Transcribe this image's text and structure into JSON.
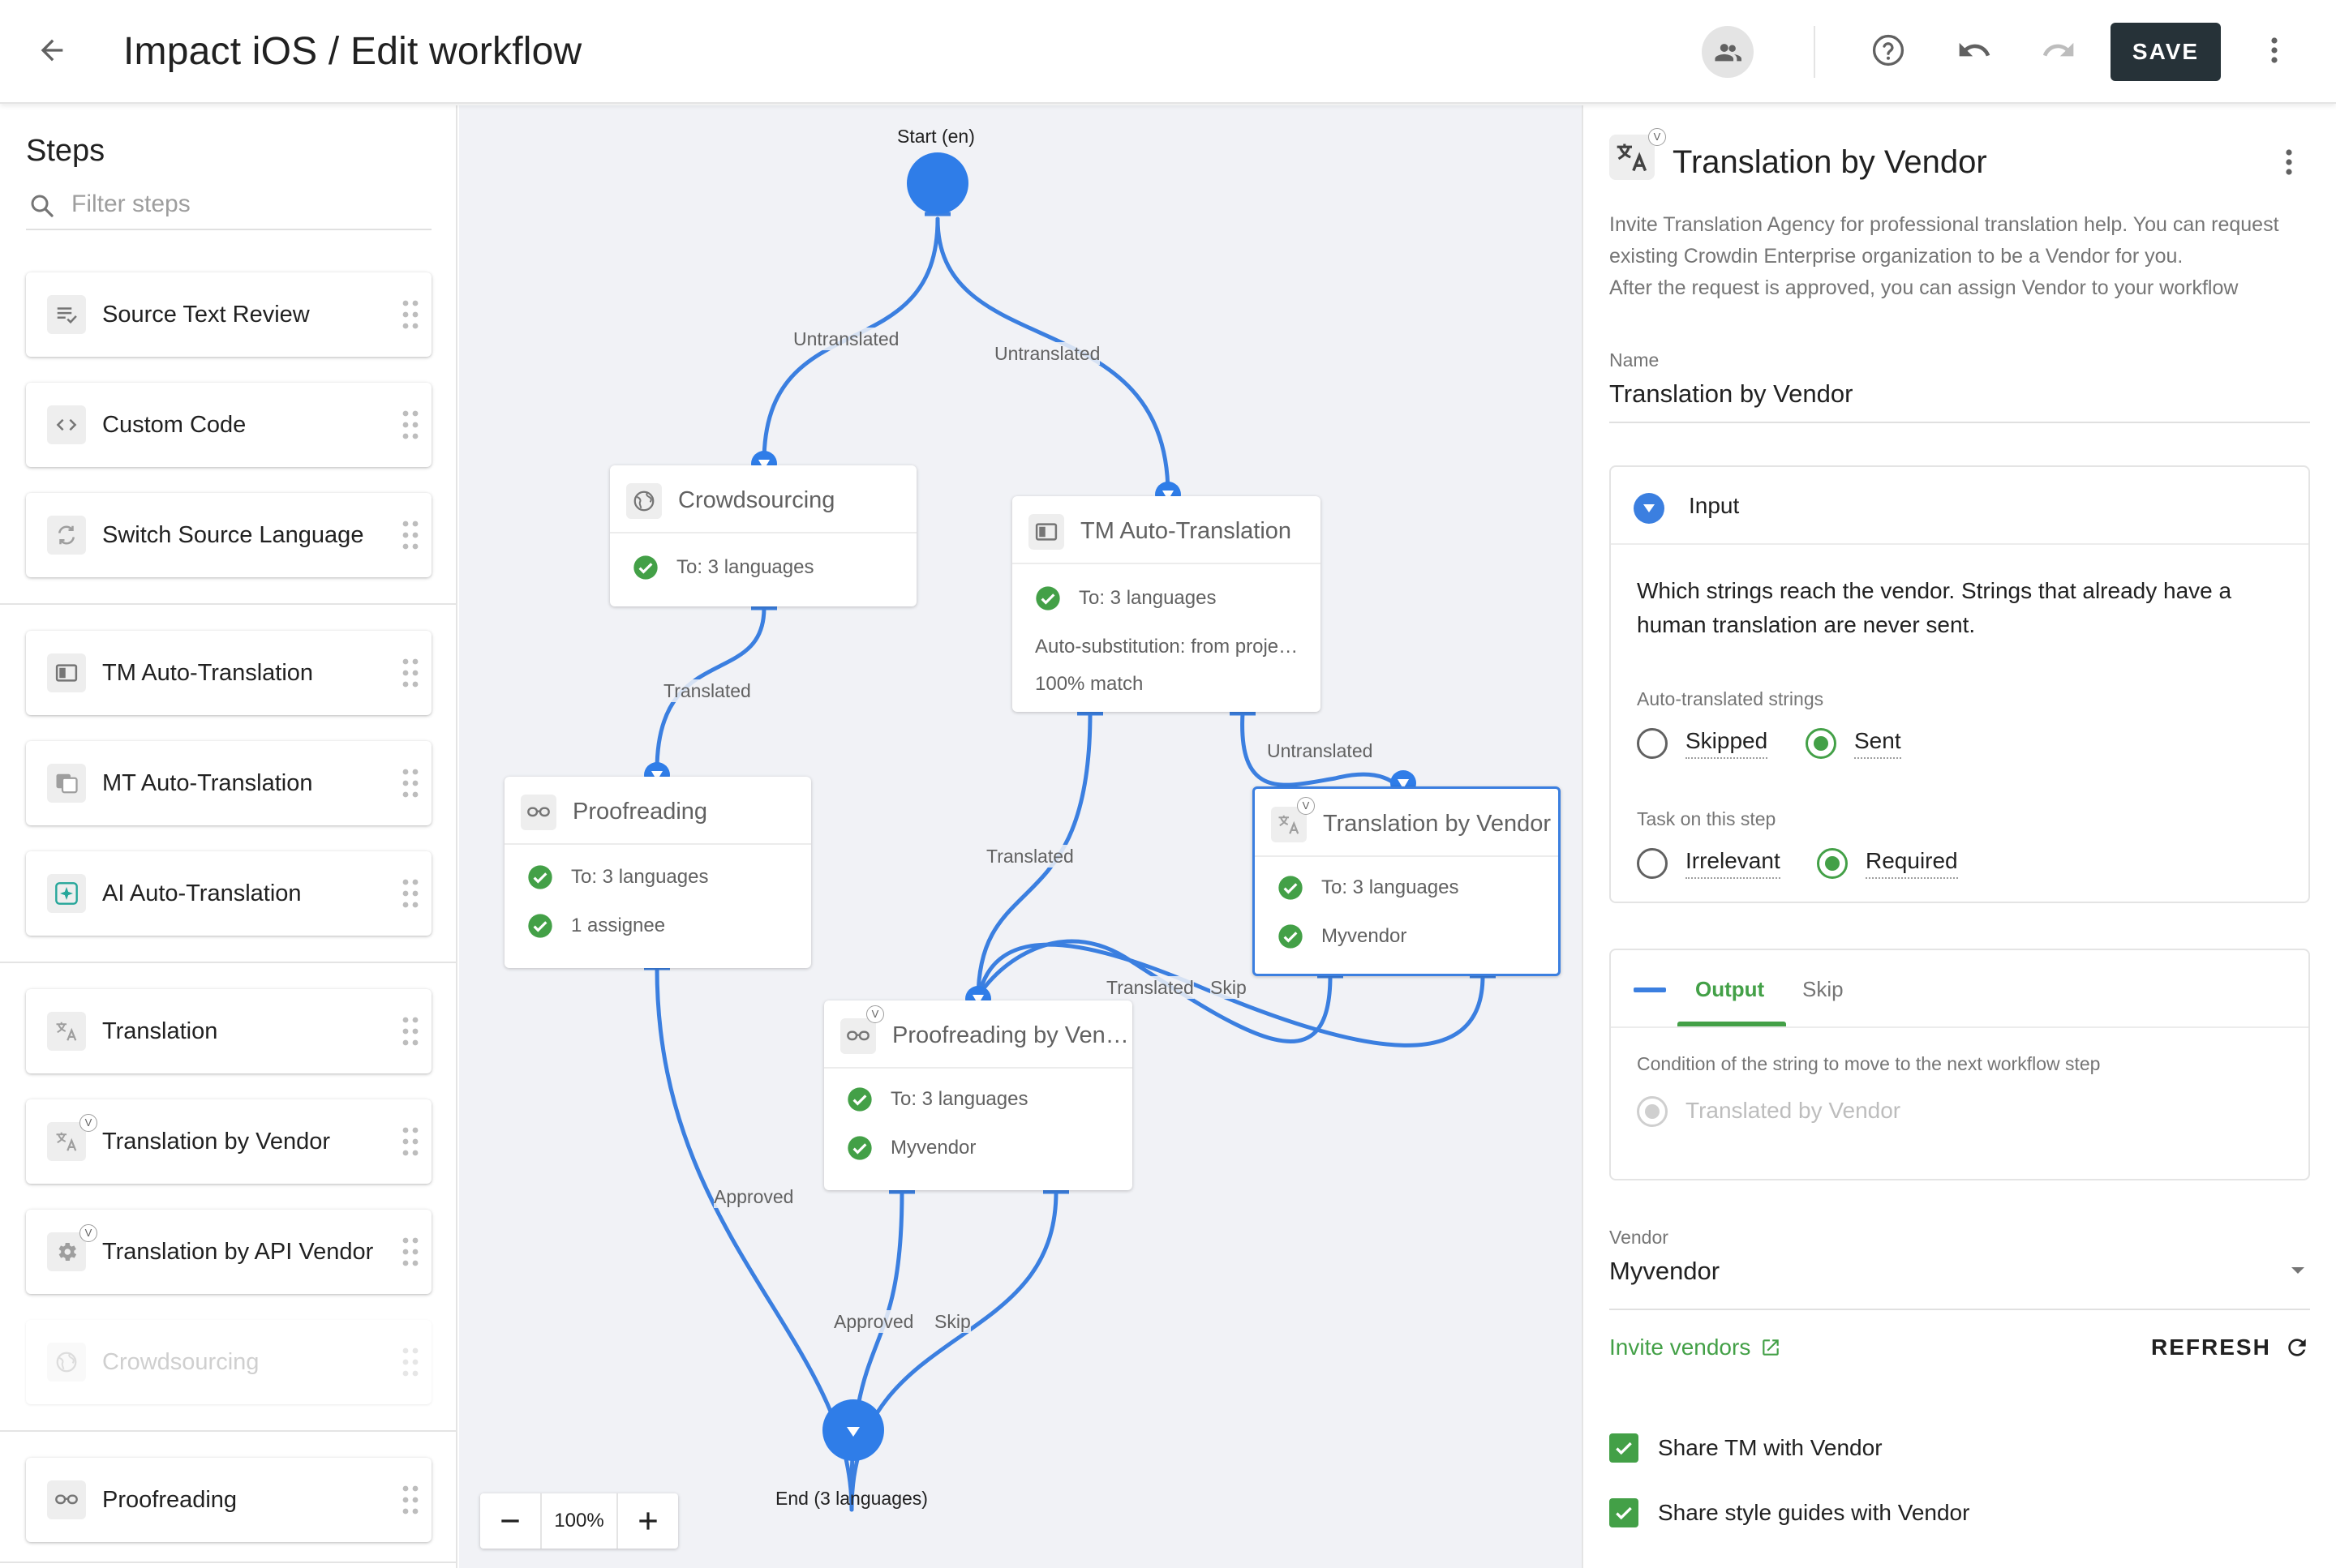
{
  "header": {
    "title": "Impact iOS / Edit workflow",
    "save_label": "SAVE"
  },
  "sidebar": {
    "title": "Steps",
    "filter_placeholder": "Filter steps",
    "items": [
      {
        "label": "Source Text Review",
        "icon": "review-icon"
      },
      {
        "label": "Custom Code",
        "icon": "code-icon"
      },
      {
        "label": "Switch Source Language",
        "icon": "switch-icon"
      },
      {
        "label": "TM Auto-Translation",
        "icon": "tm-icon"
      },
      {
        "label": "MT Auto-Translation",
        "icon": "mt-icon"
      },
      {
        "label": "AI Auto-Translation",
        "icon": "ai-icon"
      },
      {
        "label": "Translation",
        "icon": "translate-icon"
      },
      {
        "label": "Translation by Vendor",
        "icon": "translate-icon",
        "badge": "V"
      },
      {
        "label": "Translation by API Vendor",
        "icon": "gear-icon",
        "badge": "V"
      },
      {
        "label": "Crowdsourcing",
        "icon": "globe-icon",
        "disabled": true
      },
      {
        "label": "Proofreading",
        "icon": "proofreading-icon"
      }
    ]
  },
  "canvas": {
    "start_label": "Start (en)",
    "end_label": "End (3 languages)",
    "zoom": "100%",
    "nodes": {
      "crowdsourcing": {
        "title": "Crowdsourcing",
        "rows": [
          "To: 3 languages"
        ]
      },
      "tm": {
        "title": "TM Auto-Translation",
        "rows": [
          "To: 3 languages"
        ],
        "extra": [
          "Auto-substitution: from proje…",
          "100% match"
        ]
      },
      "proofreading": {
        "title": "Proofreading",
        "rows": [
          "To: 3 languages",
          "1 assignee"
        ]
      },
      "vendor": {
        "title": "Translation by Vendor",
        "rows": [
          "To: 3 languages",
          "Myvendor"
        ],
        "badge": "V"
      },
      "proof_vendor": {
        "title": "Proofreading by Ven…",
        "rows": [
          "To: 3 languages",
          "Myvendor"
        ],
        "badge": "V"
      }
    },
    "edge_labels": {
      "untranslated_left": "Untranslated",
      "untranslated_right": "Untranslated",
      "translated_crowd": "Translated",
      "translated_tm": "Translated",
      "untranslated_tm": "Untranslated",
      "translated_vendor": "Translated",
      "skip_vendor": "Skip",
      "approved_proof": "Approved",
      "approved_pv": "Approved",
      "skip_pv": "Skip"
    }
  },
  "panel": {
    "title": "Translation by Vendor",
    "badge": "V",
    "description": [
      "Invite Translation Agency for professional translation help. You can request",
      "existing Crowdin Enterprise organization to be a Vendor for you.",
      "After the request is approved, you can assign Vendor to your workflow"
    ],
    "name_label": "Name",
    "name_value": "Translation by Vendor",
    "input": {
      "label": "Input",
      "text": [
        "Which strings reach the vendor. Strings that already have a",
        "human translation are never sent."
      ],
      "auto_label": "Auto-translated strings",
      "auto_options": [
        "Skipped",
        "Sent"
      ],
      "auto_selected": "Sent",
      "task_label": "Task on this step",
      "task_options": [
        "Irrelevant",
        "Required"
      ],
      "task_selected": "Required"
    },
    "output": {
      "tabs": [
        "Output",
        "Skip"
      ],
      "active_tab": "Output",
      "condition_label": "Condition of the string to move to the next workflow step",
      "condition_value": "Translated by Vendor"
    },
    "vendor_label": "Vendor",
    "vendor_value": "Myvendor",
    "invite_link": "Invite vendors",
    "refresh_label": "REFRESH",
    "checkboxes": [
      "Share TM with Vendor",
      "Share style guides with Vendor"
    ]
  },
  "colors": {
    "accent": "#3b7fe0",
    "success": "#43a047",
    "save_bg": "#263238",
    "canvas_bg": "#f1f2f6"
  }
}
